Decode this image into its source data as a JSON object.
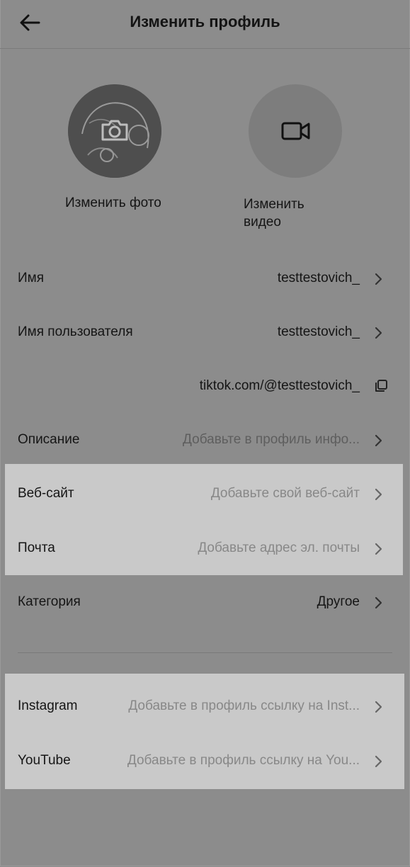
{
  "header": {
    "title": "Изменить профиль"
  },
  "media": {
    "change_photo_label": "Изменить фото",
    "change_video_label": "Изменить видео"
  },
  "fields": [
    {
      "label": "Имя",
      "value": "testtestovich_"
    },
    {
      "label": "Имя пользователя",
      "value": "testtestovich_"
    }
  ],
  "profile_link": "tiktok.com/@testtestovich_",
  "description": {
    "label": "Описание",
    "placeholder": "Добавьте в профиль инфо..."
  },
  "website": {
    "label": "Веб-сайт",
    "placeholder": "Добавьте свой веб-сайт"
  },
  "email": {
    "label": "Почта",
    "placeholder": "Добавьте адрес эл. почты"
  },
  "category": {
    "label": "Категория",
    "value": "Другое"
  },
  "social": [
    {
      "label": "Instagram",
      "placeholder": "Добавьте в профиль ссылку на Inst..."
    },
    {
      "label": "YouTube",
      "placeholder": "Добавьте в профиль ссылку на You..."
    }
  ],
  "icons": [
    "back-arrow-icon",
    "camera-icon",
    "video-camera-icon",
    "chevron-right-icon",
    "copy-icon"
  ],
  "colors": {
    "overlay_background": "#8c8c8c",
    "highlight": "#c9c9c9"
  }
}
